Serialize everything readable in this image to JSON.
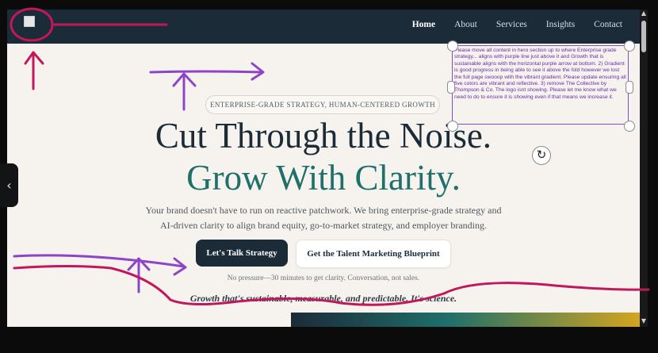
{
  "nav": {
    "items": [
      {
        "label": "Home",
        "active": true
      },
      {
        "label": "About"
      },
      {
        "label": "Services"
      },
      {
        "label": "Insights"
      },
      {
        "label": "Contact"
      }
    ]
  },
  "hero": {
    "eyebrow": "ENTERPRISE-GRADE STRATEGY, HUMAN-CENTERED GROWTH",
    "headline_line1": "Cut Through the Noise.",
    "headline_line2": "Grow With Clarity.",
    "subtext_line1": "Your brand doesn't have to run on reactive patchwork. We bring enterprise-grade strategy and",
    "subtext_line2": "AI-driven clarity to align brand equity, go-to-market strategy, and employer branding.",
    "primary_cta": "Let's Talk Strategy",
    "secondary_cta": "Get the Talent Marketing Blueprint",
    "no_pressure": "No pressure—30 minutes to get clarity. Conversation, not sales.",
    "tagline": "Growth that's sustainable, measurable, and predictable. It's science."
  },
  "annotation": {
    "note_text": "Please move all content in hero section up to where Enterprise grade strategy... aligns with purple line just above it and Growth that is sustainable aligns with the horizontal purple arrow at bottom.  2) Gradient is good progress in being able to see it above the fold however we lost the full page swooop with the vibrant gradient.  Please update ensuring all five colors are vibrant and reflective.    3) remove The Collective by Thompson & Co. The logo isnt showing. Please let me know what we need to do to ensure it is showing even if that means we increase it.",
    "pen_color_red": "#c2185b",
    "pen_color_purple": "#8e44c8"
  },
  "colors": {
    "nav_bg": "#1b2b38",
    "headline_dark": "#1b2b38",
    "headline_teal": "#1f6f6a",
    "page_bg": "#f6f3ee"
  },
  "icons": {
    "sidebar_toggle": "chevron-left-icon",
    "rotate": "rotate-icon",
    "scroll_up": "scroll-up-arrow-icon",
    "scroll_down": "scroll-down-arrow-icon"
  }
}
